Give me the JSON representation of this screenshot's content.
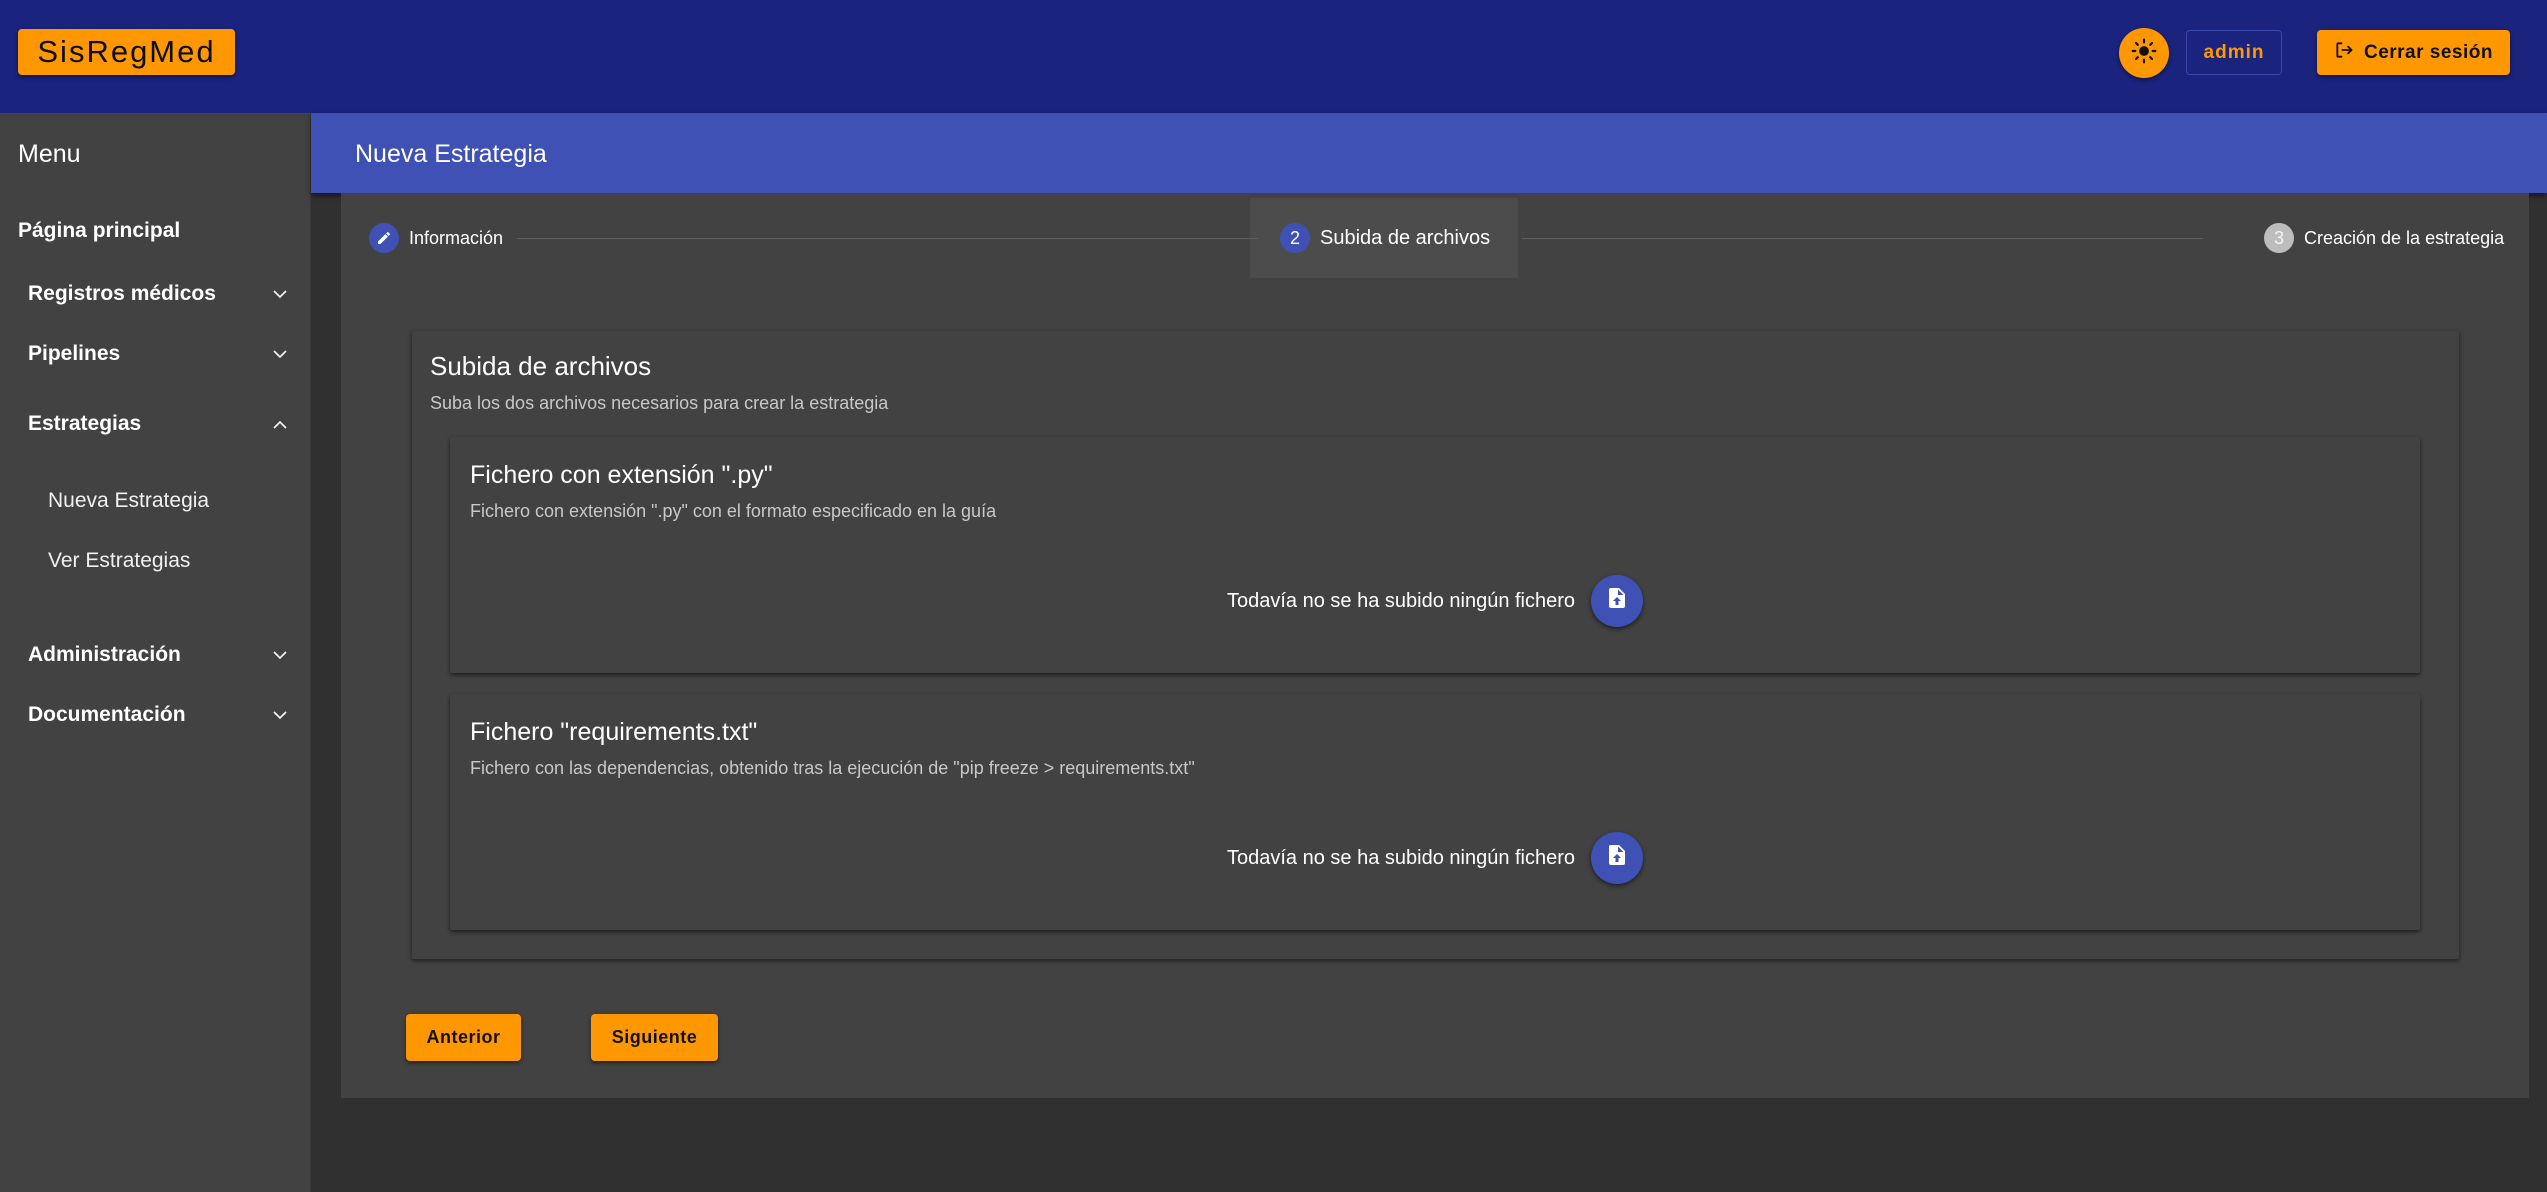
{
  "app": {
    "brand": "SisRegMed",
    "user": "admin",
    "logout_label": "Cerrar sesión"
  },
  "sidebar": {
    "title": "Menu",
    "home": "Página principal",
    "groups": [
      {
        "label": "Registros médicos",
        "expanded": false
      },
      {
        "label": "Pipelines",
        "expanded": false
      },
      {
        "label": "Estrategias",
        "expanded": true
      },
      {
        "label": "Administración",
        "expanded": false
      },
      {
        "label": "Documentación",
        "expanded": false
      }
    ],
    "estrategias_items": [
      "Nueva Estrategia",
      "Ver Estrategias"
    ]
  },
  "page": {
    "title": "Nueva Estrategia"
  },
  "stepper": {
    "steps": [
      {
        "number": "1",
        "label": "Información",
        "state": "edit"
      },
      {
        "number": "2",
        "label": "Subida de archivos",
        "state": "active"
      },
      {
        "number": "3",
        "label": "Creación de la estrategia",
        "state": "pending"
      }
    ]
  },
  "upload": {
    "title": "Subida de archivos",
    "subtitle": "Suba los dos archivos necesarios para crear la estrategia",
    "files": [
      {
        "title": "Fichero con extensión \".py\"",
        "description": "Fichero con extensión \".py\" con el formato especificado en la guía",
        "status": "Todavía no se ha subido ningún fichero"
      },
      {
        "title": "Fichero \"requirements.txt\"",
        "description": "Fichero con las dependencias, obtenido tras la ejecución de \"pip freeze > requirements.txt\"",
        "status": "Todavía no se ha subido ningún fichero"
      }
    ]
  },
  "actions": {
    "previous": "Anterior",
    "next": "Siguiente"
  },
  "colors": {
    "topbar": "#1a237e",
    "primary": "#3f51b5",
    "accent": "#ff9800",
    "sidebar": "#424242",
    "background": "#303030"
  }
}
